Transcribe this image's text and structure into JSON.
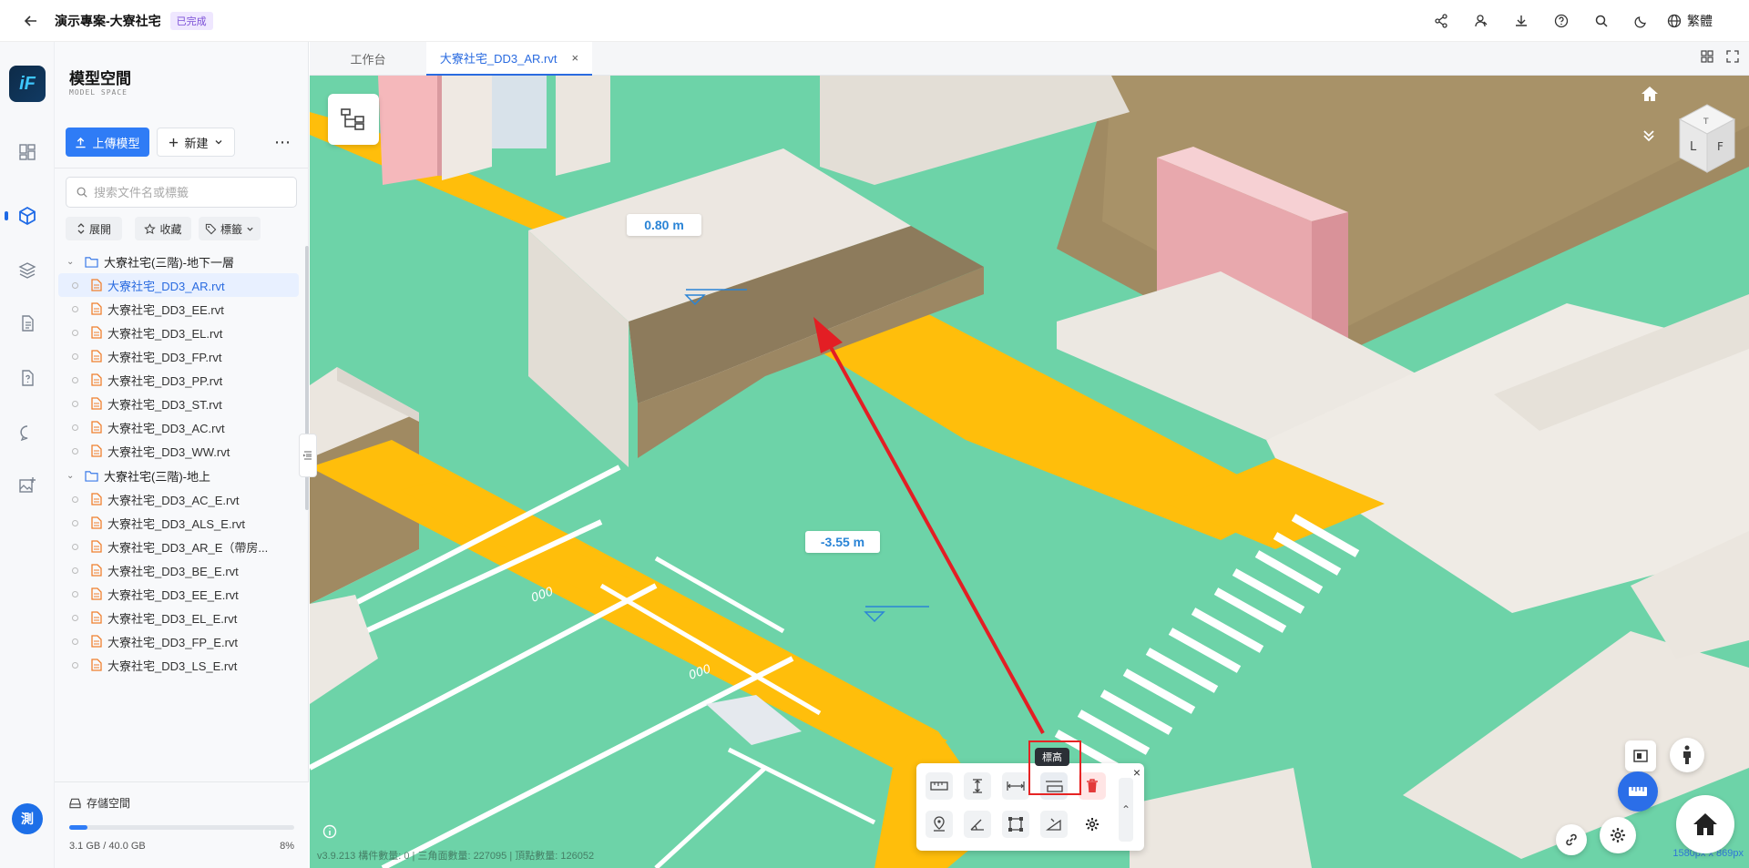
{
  "header": {
    "title": "演示專案-大寮社宅",
    "badge": "已完成",
    "language": "繁體"
  },
  "rail": {
    "avatar_text": "測"
  },
  "sidebar": {
    "title": "模型空間",
    "subtitle": "MODEL SPACE",
    "upload_label": "上傳模型",
    "new_label": "新建",
    "search_placeholder": "搜索文件名或標籤",
    "chips": [
      "展開",
      "收藏",
      "標籤"
    ],
    "folders": [
      {
        "name": "大寮社宅(三階)-地下一層",
        "files": [
          "大寮社宅_DD3_AR.rvt",
          "大寮社宅_DD3_EE.rvt",
          "大寮社宅_DD3_EL.rvt",
          "大寮社宅_DD3_FP.rvt",
          "大寮社宅_DD3_PP.rvt",
          "大寮社宅_DD3_ST.rvt",
          "大寮社宅_DD3_AC.rvt",
          "大寮社宅_DD3_WW.rvt"
        ]
      },
      {
        "name": "大寮社宅(三階)-地上",
        "files": [
          "大寮社宅_DD3_AC_E.rvt",
          "大寮社宅_DD3_ALS_E.rvt",
          "大寮社宅_DD3_AR_E（帶房...",
          "大寮社宅_DD3_BE_E.rvt",
          "大寮社宅_DD3_EE_E.rvt",
          "大寮社宅_DD3_EL_E.rvt",
          "大寮社宅_DD3_FP_E.rvt",
          "大寮社宅_DD3_LS_E.rvt"
        ]
      }
    ],
    "storage": {
      "label": "存儲空間",
      "used": "3.1 GB / 40.0 GB",
      "percent_text": "8%",
      "fraction": 0.08
    }
  },
  "tabs": [
    {
      "label": "工作台",
      "active": false
    },
    {
      "label": "大寮社宅_DD3_AR.rvt",
      "active": true
    }
  ],
  "viewport": {
    "viewcube_left": "L",
    "viewcube_top": "T",
    "viewcube_front": "F",
    "tag_upper": "0.80 m",
    "tag_lower": "-3.55 m",
    "tooltip": "標高",
    "status": "v3.9.213  構件數量: 0 | 三角面數量: 227095 | 頂點數量: 126052",
    "resolution": "1580px x 869px"
  },
  "colors": {
    "accent": "#2f7cf6",
    "floor": "#6dd3a8",
    "road_line": "#ffbe0b",
    "highlight": "#e62424"
  }
}
